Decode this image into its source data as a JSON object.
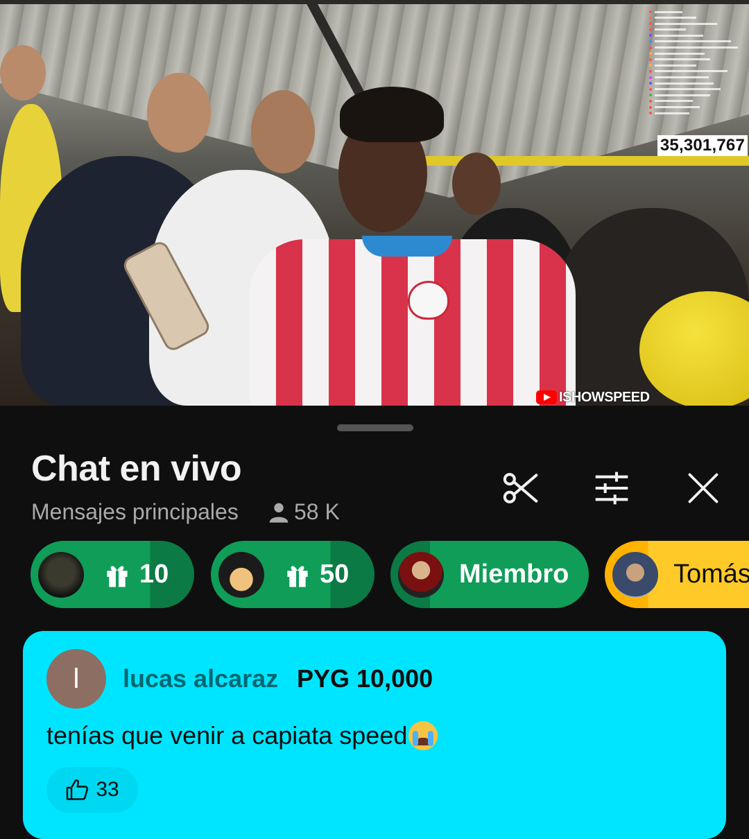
{
  "video": {
    "viewer_count": "35,301,767",
    "channel_watermark": "ISHOWSPEED"
  },
  "chat": {
    "title": "Chat en vivo",
    "mode": "Mensajes principales",
    "viewers": "58 K",
    "icons": [
      "scissors-icon",
      "tune-icon",
      "close-icon"
    ],
    "tickers": [
      {
        "type": "gift",
        "count": "10",
        "color": "#0f9d58",
        "dark": "#0b7a44"
      },
      {
        "type": "gift",
        "count": "50",
        "color": "#0f9d58",
        "dark": "#0b7a44"
      },
      {
        "type": "member",
        "label": "Miembro",
        "color": "#0f9d58",
        "dark": "#0b7a44"
      },
      {
        "type": "superchat",
        "label": "Tomás",
        "color": "#ffca28",
        "dark": "#ffb300"
      }
    ]
  },
  "super_chat": {
    "avatar_initial": "l",
    "author": "lucas alcaraz",
    "amount": "PYG 10,000",
    "message": "tenías que venir a capiata speed",
    "likes": "33",
    "background": "#00e5ff"
  }
}
